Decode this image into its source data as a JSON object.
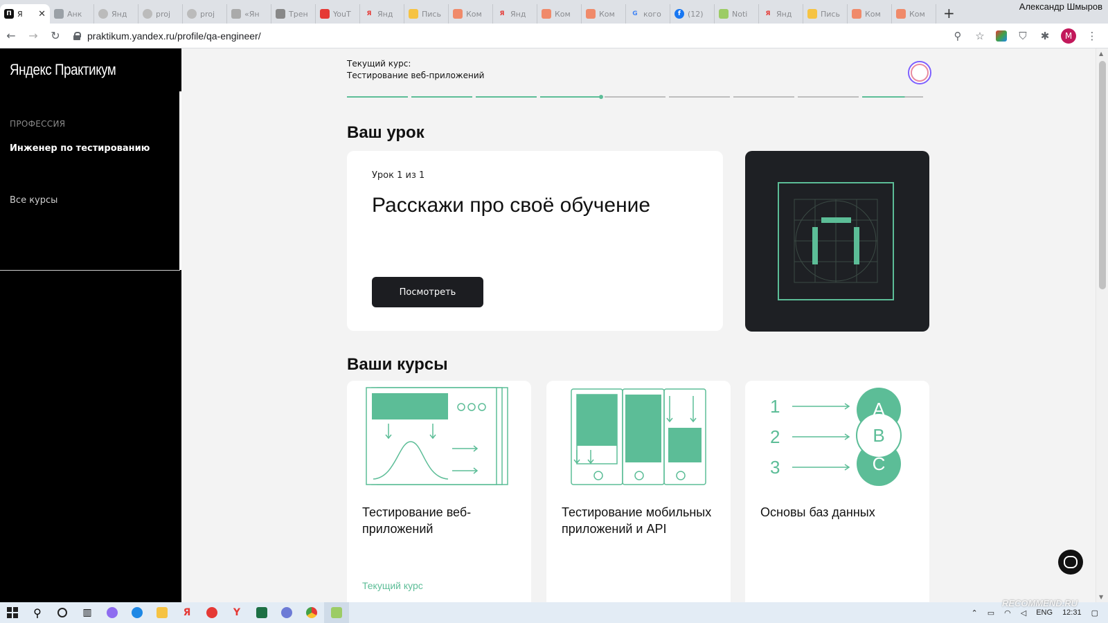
{
  "browser": {
    "tabs": [
      {
        "label": "Я",
        "active": true
      },
      {
        "label": "Анк"
      },
      {
        "label": "Янд"
      },
      {
        "label": "proj"
      },
      {
        "label": "proj"
      },
      {
        "label": "«Ян"
      },
      {
        "label": "Трен"
      },
      {
        "label": "YouT"
      },
      {
        "label": "Янд"
      },
      {
        "label": "Пись"
      },
      {
        "label": "Ком"
      },
      {
        "label": "Янд"
      },
      {
        "label": "Ком"
      },
      {
        "label": "Ком"
      },
      {
        "label": "кого"
      },
      {
        "label": "(12)"
      },
      {
        "label": "Noti"
      },
      {
        "label": "Янд"
      },
      {
        "label": "Пись"
      },
      {
        "label": "Ком"
      },
      {
        "label": "Ком"
      }
    ],
    "new_tab": "+",
    "profile_name": "Александр Шмыров",
    "url": "praktikum.yandex.ru/profile/qa-engineer/",
    "profile_initial": "M"
  },
  "sidebar": {
    "logo": "Яндекс Практикум",
    "section_label": "ПРОФЕССИЯ",
    "profession": "Инженер по тестированию",
    "all_courses": "Все курсы"
  },
  "header": {
    "current_course_label": "Текущий курс:",
    "current_course_name": "Тестирование веб-приложений",
    "progress_segments": 9,
    "progress_completed": 4
  },
  "lesson": {
    "heading": "Ваш урок",
    "counter": "Урок 1 из 1",
    "title": "Расскажи про своё обучение",
    "button": "Посмотреть"
  },
  "courses": {
    "heading": "Ваши курсы",
    "items": [
      {
        "title": "Тестирование веб-приложений",
        "status": "Текущий курс"
      },
      {
        "title": "Тестирование мобильных приложений и API",
        "status": ""
      },
      {
        "title": "Основы баз данных",
        "status": ""
      }
    ],
    "db_illustration": {
      "numbers": [
        "1",
        "2",
        "3"
      ],
      "letters": [
        "A",
        "B",
        "C"
      ]
    }
  },
  "taskbar": {
    "lang": "ENG",
    "time": "12:31"
  },
  "watermark": "RECOMMEND.RU",
  "colors": {
    "accent_green": "#5cbd97",
    "dark_button": "#1c1d21",
    "sidebar_bg": "#000000"
  }
}
